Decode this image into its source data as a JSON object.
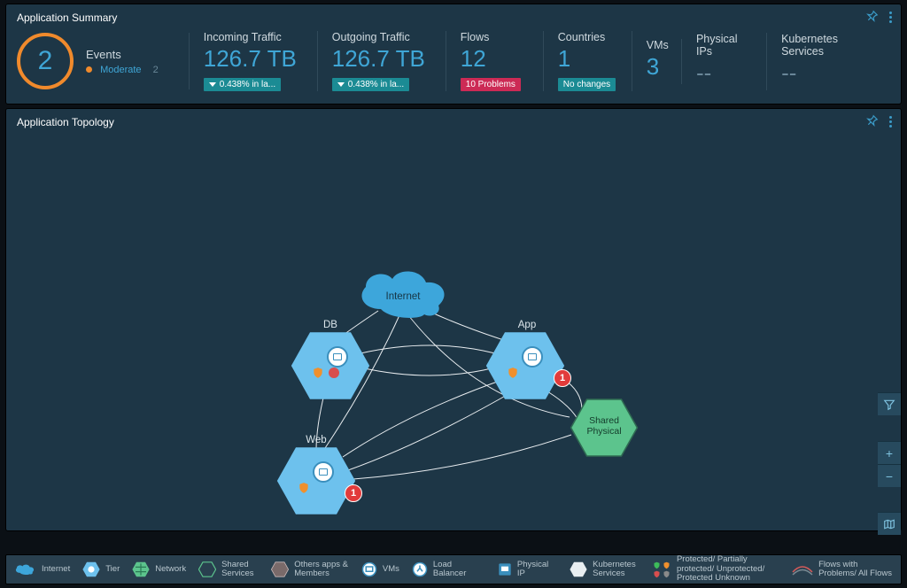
{
  "summary": {
    "title": "Application Summary",
    "events": {
      "label": "Events",
      "count": "2",
      "moderate_label": "Moderate",
      "moderate_count": "2"
    },
    "metrics": {
      "incoming": {
        "label": "Incoming Traffic",
        "value": "126.7 TB",
        "badge": "0.438% in la..."
      },
      "outgoing": {
        "label": "Outgoing Traffic",
        "value": "126.7 TB",
        "badge": "0.438% in la..."
      },
      "flows": {
        "label": "Flows",
        "value": "12",
        "badge": "10 Problems"
      },
      "countries": {
        "label": "Countries",
        "value": "1",
        "badge": "No changes"
      },
      "vms": {
        "label": "VMs",
        "value": "3"
      },
      "pips": {
        "label": "Physical IPs",
        "value": "--"
      },
      "k8s": {
        "label": "Kubernetes Services",
        "value": "--"
      }
    }
  },
  "topology": {
    "title": "Application Topology",
    "nodes": {
      "internet": "Internet",
      "db": "DB",
      "app": "App",
      "web": "Web",
      "shared": "Shared Physical",
      "app_count": "1",
      "web_count": "1"
    }
  },
  "legend": {
    "internet": "Internet",
    "tier": "Tier",
    "network": "Network",
    "shared": "Shared Services",
    "others": "Others apps & Members",
    "vms": "VMs",
    "lb": "Load Balancer",
    "pip": "Physical IP",
    "k8s": "Kubernetes Services",
    "prot": "Protected/ Partially protected/ Unprotected/ Protected Unknown",
    "flows": "Flows with Problems/ All Flows"
  }
}
